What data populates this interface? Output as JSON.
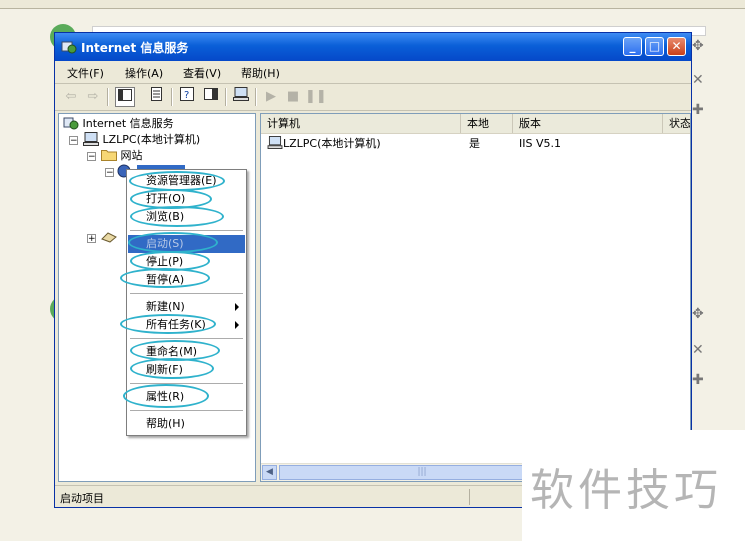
{
  "window": {
    "title": "Internet 信息服务",
    "accent": "#0a5fd8"
  },
  "menubar": {
    "items": [
      "文件(F)",
      "操作(A)",
      "查看(V)",
      "帮助(H)"
    ]
  },
  "toolbar": {
    "icons": [
      "back-arrow-icon",
      "forward-arrow-icon",
      "show-tree-icon",
      "export-list-icon",
      "properties-icon",
      "help-icon",
      "console-view-icon",
      "computer-icon",
      "start-icon",
      "stop-icon",
      "pause-icon"
    ]
  },
  "tree": {
    "root": "Internet 信息服务",
    "computer": "LZLPC(本地计算机)",
    "websites": "网站"
  },
  "list": {
    "columns": [
      "计算机",
      "本地",
      "版本",
      "状态"
    ],
    "rows": [
      {
        "computer": "LZLPC(本地计算机)",
        "local": "是",
        "version": "IIS V5.1"
      }
    ]
  },
  "context_menu": {
    "items": [
      {
        "label": "资源管理器(E)"
      },
      {
        "label": "打开(O)"
      },
      {
        "label": "浏览(B)"
      },
      {
        "label": "启动(S)"
      },
      {
        "label": "停止(P)"
      },
      {
        "label": "暂停(A)"
      },
      {
        "label": "新建(N)"
      },
      {
        "label": "所有任务(K)"
      },
      {
        "label": "重命名(M)"
      },
      {
        "label": "刷新(F)"
      },
      {
        "label": "属性(R)"
      },
      {
        "label": "帮助(H)"
      }
    ],
    "highlighted": "启动(S)",
    "ring_color": "#2fb2cc"
  },
  "statusbar": {
    "text": "启动项目"
  },
  "watermark": {
    "text": "软件技巧"
  }
}
